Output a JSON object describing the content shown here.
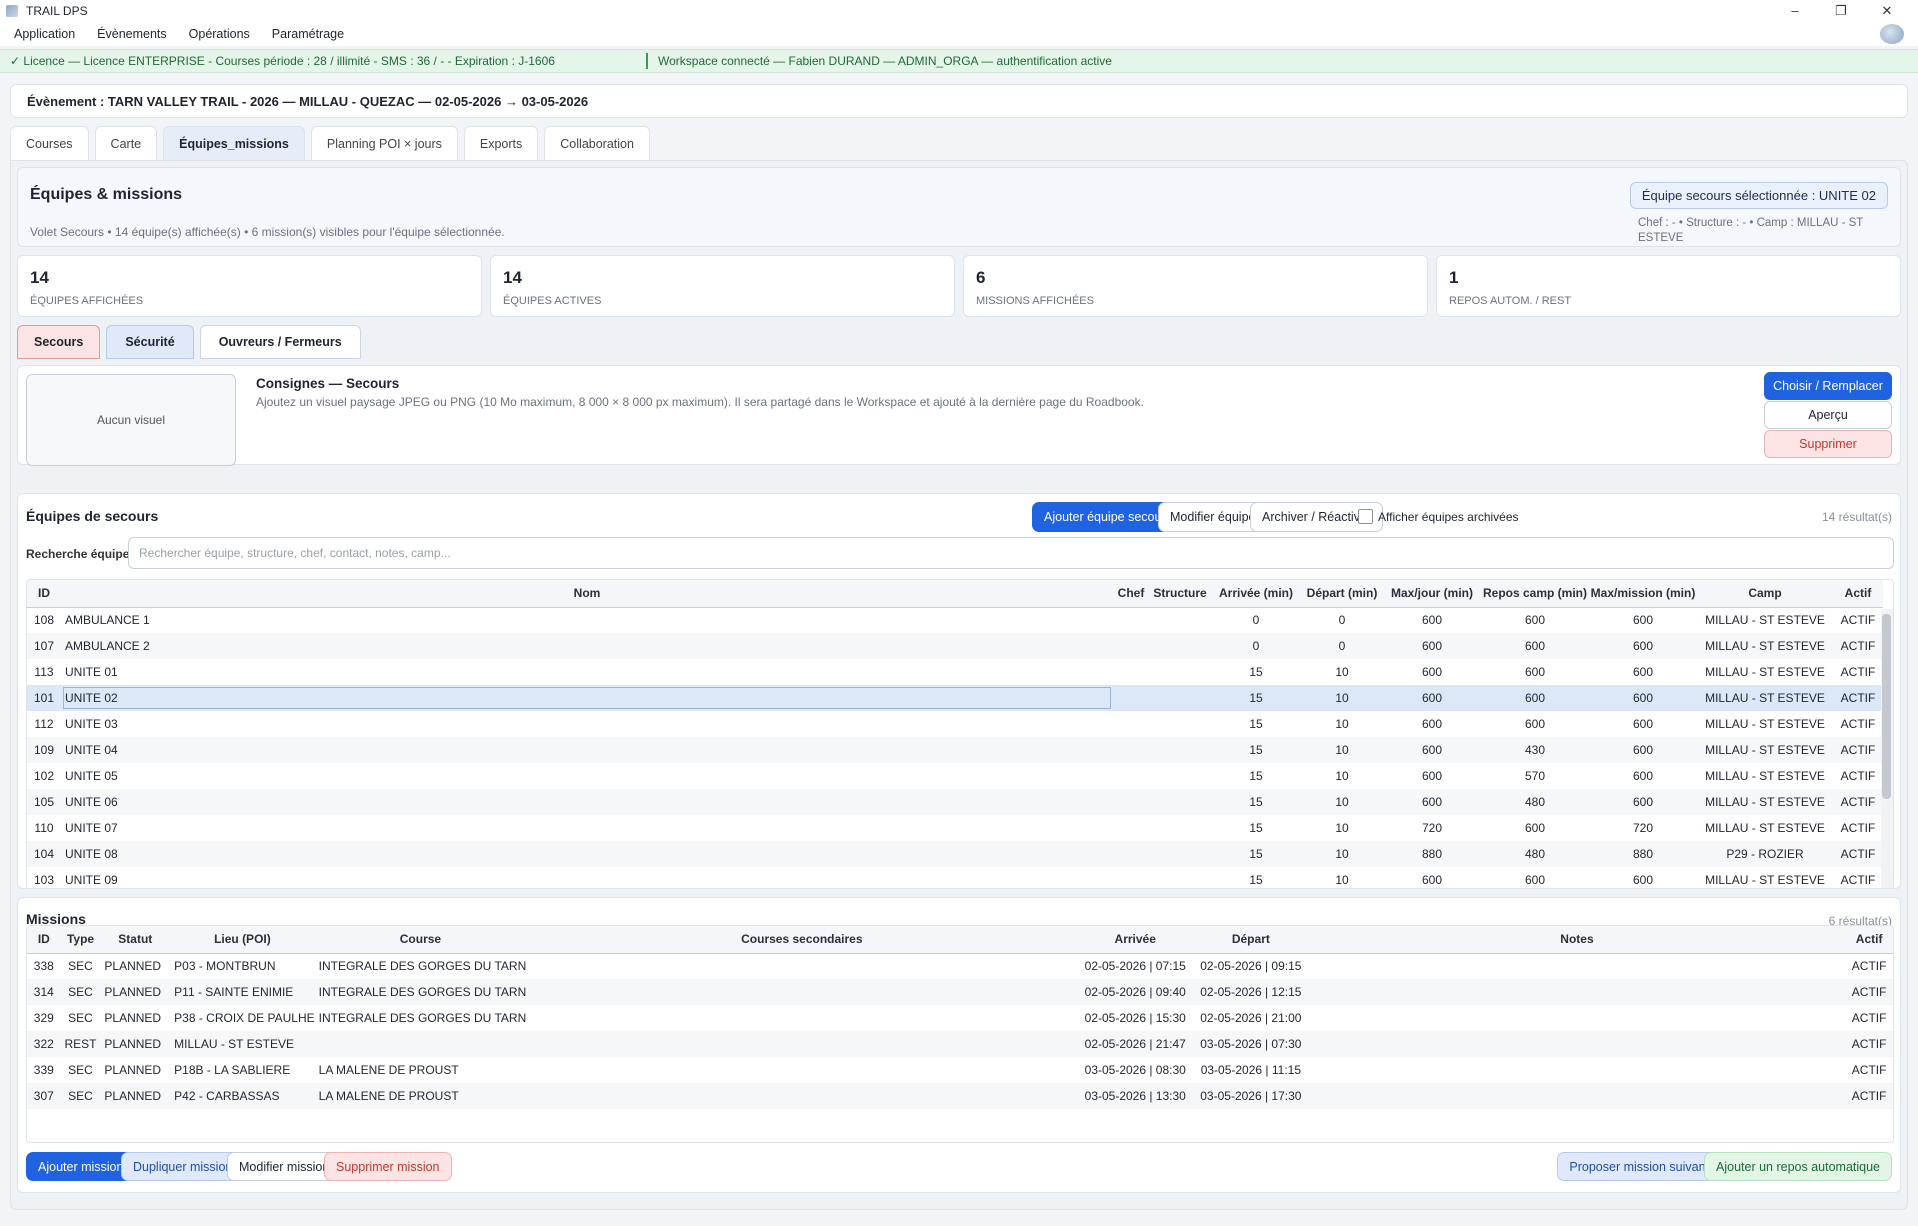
{
  "window": {
    "title": "TRAIL DPS",
    "minimize": "–",
    "restore": "❐",
    "close": "✕"
  },
  "menu": [
    "Application",
    "Évènements",
    "Opérations",
    "Paramétrage"
  ],
  "license": {
    "text": "✓ Licence — Licence ENTERPRISE - Courses période : 28 / illimité - SMS : 36 / - - Expiration : J-1606",
    "workspace": "Workspace connecté — Fabien DURAND — ADMIN_ORGA — authentification active"
  },
  "event": {
    "label": "Évènement : TARN VALLEY TRAIL - 2026 — MILLAU - QUEZAC — 02-05-2026 → 03-05-2026"
  },
  "tabs": [
    "Courses",
    "Carte",
    "Équipes_missions",
    "Planning POI × jours",
    "Exports",
    "Collaboration"
  ],
  "header": {
    "title": "Équipes & missions",
    "subtitle": "Volet Secours • 14 équipe(s) affichée(s) • 6 mission(s) visibles pour l'équipe sélectionnée.",
    "selected": "Équipe secours sélectionnée : UNITE 02",
    "selected_info": "Chef : - • Structure : - • Camp : MILLAU - ST ESTEVE"
  },
  "stats": [
    {
      "value": "14",
      "label": "Équipes affichées"
    },
    {
      "value": "14",
      "label": "Équipes actives"
    },
    {
      "value": "6",
      "label": "Missions affichées"
    },
    {
      "value": "1",
      "label": "Repos autom. / REST"
    }
  ],
  "subtabs": [
    "Secours",
    "Sécurité",
    "Ouvreurs / Fermeurs"
  ],
  "consignes": {
    "visual_placeholder": "Aucun visuel",
    "title": "Consignes — Secours",
    "text": "Ajoutez un visuel paysage JPEG ou PNG (10 Mo maximum, 8 000 × 8 000 px maximum). Il sera partagé dans le Workspace et ajouté à la dernière page du Roadbook.",
    "choose": "Choisir / Remplacer",
    "preview": "Aperçu",
    "delete": "Supprimer"
  },
  "teams": {
    "title": "Équipes de secours",
    "add": "Ajouter équipe secours",
    "edit": "Modifier équipe",
    "archive": "Archiver / Réactiver",
    "show_archived": "Afficher équipes archivées",
    "results": "14 résultat(s)",
    "search_label": "Recherche équipe",
    "search_placeholder": "Rechercher équipe, structure, chef, contact, notes, camp...",
    "columns": [
      "ID",
      "Nom",
      "Chef",
      "Structure",
      "Arrivée (min)",
      "Départ (min)",
      "Max/jour (min)",
      "Repos camp (min)",
      "Max/mission (min)",
      "Camp",
      "Actif"
    ],
    "rows": [
      [
        "108",
        "AMBULANCE 1",
        "",
        "",
        "0",
        "0",
        "600",
        "600",
        "600",
        "MILLAU - ST ESTEVE",
        "ACTIF"
      ],
      [
        "107",
        "AMBULANCE 2",
        "",
        "",
        "0",
        "0",
        "600",
        "600",
        "600",
        "MILLAU - ST ESTEVE",
        "ACTIF"
      ],
      [
        "113",
        "UNITE 01",
        "",
        "",
        "15",
        "10",
        "600",
        "600",
        "600",
        "MILLAU - ST ESTEVE",
        "ACTIF"
      ],
      [
        "101",
        "UNITE 02",
        "",
        "",
        "15",
        "10",
        "600",
        "600",
        "600",
        "MILLAU - ST ESTEVE",
        "ACTIF"
      ],
      [
        "112",
        "UNITE 03",
        "",
        "",
        "15",
        "10",
        "600",
        "600",
        "600",
        "MILLAU - ST ESTEVE",
        "ACTIF"
      ],
      [
        "109",
        "UNITE 04",
        "",
        "",
        "15",
        "10",
        "600",
        "430",
        "600",
        "MILLAU - ST ESTEVE",
        "ACTIF"
      ],
      [
        "102",
        "UNITE 05",
        "",
        "",
        "15",
        "10",
        "600",
        "570",
        "600",
        "MILLAU - ST ESTEVE",
        "ACTIF"
      ],
      [
        "105",
        "UNITE 06",
        "",
        "",
        "15",
        "10",
        "600",
        "480",
        "600",
        "MILLAU - ST ESTEVE",
        "ACTIF"
      ],
      [
        "110",
        "UNITE 07",
        "",
        "",
        "15",
        "10",
        "720",
        "600",
        "720",
        "MILLAU - ST ESTEVE",
        "ACTIF"
      ],
      [
        "104",
        "UNITE 08",
        "",
        "",
        "15",
        "10",
        "880",
        "480",
        "880",
        "P29 - ROZIER",
        "ACTIF"
      ],
      [
        "103",
        "UNITE 09",
        "",
        "",
        "15",
        "10",
        "600",
        "600",
        "600",
        "MILLAU - ST ESTEVE",
        "ACTIF"
      ]
    ],
    "selected_index": 3
  },
  "missions": {
    "title": "Missions",
    "results": "6 résultat(s)",
    "columns": [
      "ID",
      "Type",
      "Statut",
      "Lieu (POI)",
      "Course",
      "Courses secondaires",
      "Arrivée",
      "Départ",
      "Notes",
      "Actif"
    ],
    "rows": [
      [
        "338",
        "SEC",
        "PLANNED",
        "P03 - MONTBRUN",
        "INTEGRALE DES GORGES DU TARN",
        "",
        "02-05-2026 | 07:15",
        "02-05-2026 | 09:15",
        "",
        "ACTIF"
      ],
      [
        "314",
        "SEC",
        "PLANNED",
        "P11 - SAINTE ENIMIE",
        "INTEGRALE DES GORGES DU TARN",
        "",
        "02-05-2026 | 09:40",
        "02-05-2026 | 12:15",
        "",
        "ACTIF"
      ],
      [
        "329",
        "SEC",
        "PLANNED",
        "P38 - CROIX DE PAULHE",
        "INTEGRALE DES GORGES DU TARN",
        "",
        "02-05-2026 | 15:30",
        "02-05-2026 | 21:00",
        "",
        "ACTIF"
      ],
      [
        "322",
        "REST",
        "PLANNED",
        "MILLAU - ST ESTEVE",
        "",
        "",
        "02-05-2026 | 21:47",
        "03-05-2026 | 07:30",
        "",
        "ACTIF"
      ],
      [
        "339",
        "SEC",
        "PLANNED",
        "P18B - LA SABLIERE",
        "LA MALENE DE PROUST",
        "",
        "03-05-2026 | 08:30",
        "03-05-2026 | 11:15",
        "",
        "ACTIF"
      ],
      [
        "307",
        "SEC",
        "PLANNED",
        "P42 - CARBASSAS",
        "LA MALENE DE PROUST",
        "",
        "03-05-2026 | 13:30",
        "03-05-2026 | 17:30",
        "",
        "ACTIF"
      ]
    ],
    "buttons": {
      "add": "Ajouter mission",
      "duplicate": "Dupliquer mission",
      "edit": "Modifier mission",
      "delete": "Supprimer mission",
      "propose": "Proposer mission suivante",
      "auto_rest": "Ajouter un repos automatique"
    }
  }
}
